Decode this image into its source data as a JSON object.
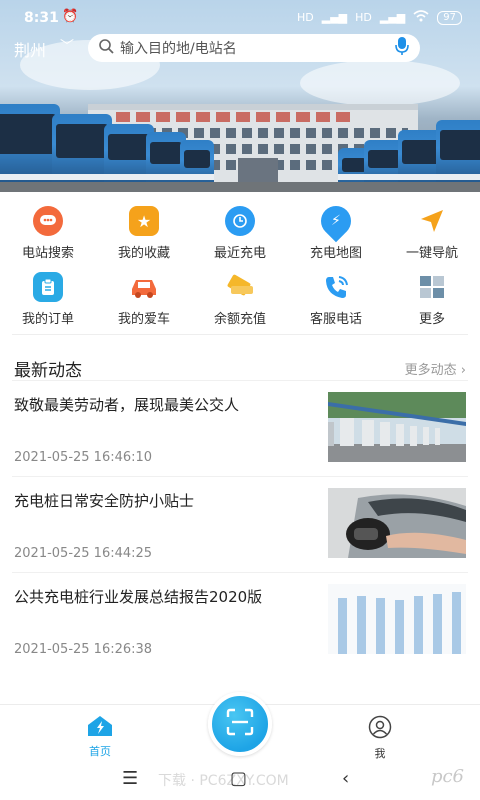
{
  "status": {
    "time": "8:31",
    "network1": "HD",
    "network2": "HD",
    "battery": "97"
  },
  "topbar": {
    "city": "荆州",
    "search_placeholder": "输入目的地/电站名"
  },
  "grid": {
    "row1": [
      {
        "label": "电站搜索",
        "icon": "station-search-icon",
        "color": "#f36a3c"
      },
      {
        "label": "我的收藏",
        "icon": "star-icon",
        "color": "#f5a21b"
      },
      {
        "label": "最近充电",
        "icon": "clock-icon",
        "color": "#2b9cf2"
      },
      {
        "label": "充电地图",
        "icon": "map-bolt-icon",
        "color": "#2b9cf2"
      },
      {
        "label": "一键导航",
        "icon": "navigation-arrow-icon",
        "color": "#f5a21b"
      }
    ],
    "row2": [
      {
        "label": "我的订单",
        "icon": "clipboard-icon",
        "color": "#2aaae5"
      },
      {
        "label": "我的爱车",
        "icon": "car-icon",
        "color": "#f36a3c"
      },
      {
        "label": "余额充值",
        "icon": "card-icon",
        "color": "#f5b72a"
      },
      {
        "label": "客服电话",
        "icon": "phone-icon",
        "color": "#2b9cf2"
      },
      {
        "label": "更多",
        "icon": "grid-icon",
        "color": "#6d8fa8"
      }
    ]
  },
  "news": {
    "title": "最新动态",
    "more": "更多动态 ›",
    "articles": [
      {
        "title": "致敬最美劳动者，展现最美公交人",
        "time": "2021-05-25 16:46:10"
      },
      {
        "title": "充电桩日常安全防护小贴士",
        "time": "2021-05-25 16:44:25"
      },
      {
        "title": "公共充电桩行业发展总结报告2020版",
        "time": "2021-05-25 16:26:38"
      }
    ]
  },
  "bottom_nav": {
    "home": "首页",
    "me": "我"
  },
  "system": {
    "watermark": "下载 · PC6ZXY.COM",
    "brand": "pc6"
  }
}
